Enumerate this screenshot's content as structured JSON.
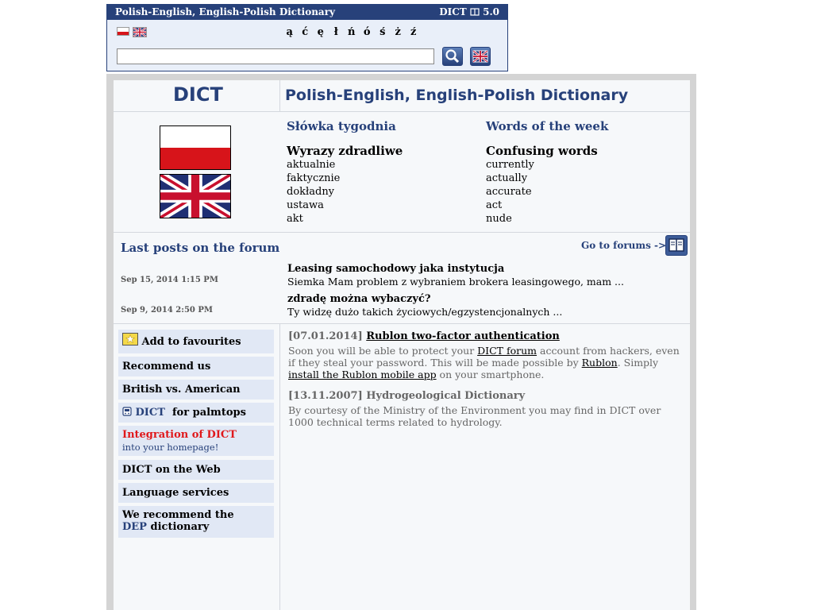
{
  "widget": {
    "title": "Polish-English, English-Polish Dictionary",
    "version_left": "DICT",
    "version_right": "5.0",
    "special_chars": [
      "ą",
      "ć",
      "ę",
      "ł",
      "ń",
      "ó",
      "ś",
      "ż",
      "ź"
    ],
    "search_value": ""
  },
  "header": {
    "brand": "DICT",
    "title": "Polish-English, English-Polish Dictionary"
  },
  "words_of_week": {
    "pl_heading": "Słówka tygodnia",
    "en_heading": "Words of the week",
    "pl_topic": "Wyrazy zdradliwe",
    "en_topic": "Confusing words",
    "pl_words": [
      "aktualnie",
      "faktycznie",
      "dokładny",
      "ustawa",
      "akt"
    ],
    "en_words": [
      "currently",
      "actually",
      "accurate",
      "act",
      "nude"
    ]
  },
  "forum": {
    "heading": "Last posts on the forum",
    "link": "Go to forums ->",
    "posts": [
      {
        "date": "Sep 15, 2014 1:15 PM",
        "title": "Leasing samochodowy jaka instytucja",
        "text": "Siemka Mam problem z wybraniem brokera leasingowego, mam ..."
      },
      {
        "date": "Sep 9, 2014 2:50 PM",
        "title": "zdradę można wybaczyć?",
        "text": "Ty widzę dużo takich życiowych/egzystencjonalnych ..."
      }
    ]
  },
  "sidebar": {
    "favourites": "Add to favourites",
    "recommend": "Recommend us",
    "british": "British vs. American",
    "palmtops_brand": "DICT",
    "palmtops": "for palmtops",
    "integration": "Integration of DICT",
    "integration_sub": "into your homepage!",
    "on_web": "DICT on the Web",
    "language": "Language services",
    "recommend_dep_1": "We recommend the",
    "recommend_dep_brand": "DEP",
    "recommend_dep_2": "dictionary"
  },
  "news": [
    {
      "date": "[07.01.2014]",
      "title": "Rublon two-factor authentication",
      "p1": "Soon you will be able to protect your ",
      "link1": "DICT forum",
      "p2": " account from hackers, even if they steal your password. This will be made possible by ",
      "link2": "Rublon",
      "p3": ". Simply ",
      "link3": "install the Rublon mobile app",
      "p4": " on your smartphone."
    },
    {
      "date": "[13.11.2007]",
      "title": "Hydrogeological Dictionary",
      "text": "By courtesy of the Ministry of the Environment you may find in DICT over 1000 technical terms related to hydrology."
    }
  ],
  "colors": {
    "navy": "#27417a",
    "panel": "#f6f8fa",
    "sidebar_item": "#e1e8f5",
    "integration_red": "#e0181b"
  }
}
